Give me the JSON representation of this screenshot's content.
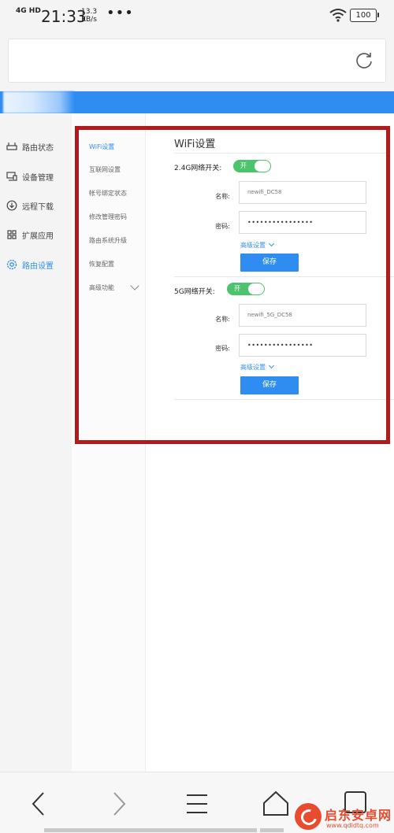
{
  "status_bar": {
    "network": "4G HD",
    "time": "21:33",
    "speed_value": "13.3",
    "speed_unit": "KB/s",
    "more": "•••",
    "battery": "100"
  },
  "main_nav": {
    "items": [
      {
        "label": "路由状态",
        "icon": "router-icon",
        "active": false
      },
      {
        "label": "设备管理",
        "icon": "device-icon",
        "active": false
      },
      {
        "label": "远程下载",
        "icon": "download-icon",
        "active": false
      },
      {
        "label": "扩展应用",
        "icon": "apps-grid-icon",
        "active": false
      },
      {
        "label": "路由设置",
        "icon": "gear-icon",
        "active": true
      }
    ]
  },
  "sub_nav": {
    "items": [
      {
        "label": "WiFi设置",
        "active": true
      },
      {
        "label": "互联网设置",
        "active": false
      },
      {
        "label": "帐号绑定状态",
        "active": false
      },
      {
        "label": "修改管理密码",
        "active": false
      },
      {
        "label": "路由系统升级",
        "active": false
      },
      {
        "label": "恢复配置",
        "active": false
      },
      {
        "label": "高级功能",
        "active": false
      }
    ]
  },
  "content": {
    "title": "WiFi设置",
    "band_24": {
      "switch_label": "2.4G网络开关:",
      "toggle_text": "开",
      "name_label": "名称:",
      "name_value": "newifi_DC58",
      "password_label": "密码:",
      "password_value": "••••••••••••••••",
      "advanced": "高级设置",
      "save": "保存"
    },
    "band_5": {
      "switch_label": "5G网络开关:",
      "toggle_text": "开",
      "name_label": "名称:",
      "name_value": "newifi_5G_DC58",
      "password_label": "密码:",
      "password_value": "••••••••••••••••",
      "advanced": "高级设置",
      "save": "保存"
    }
  },
  "watermark": {
    "name": "启东安卓网",
    "url": "www.qdldtq.com"
  },
  "colors": {
    "accent": "#2f8df1",
    "toggle_on": "#4cc36d",
    "highlight": "#b01c1c"
  }
}
